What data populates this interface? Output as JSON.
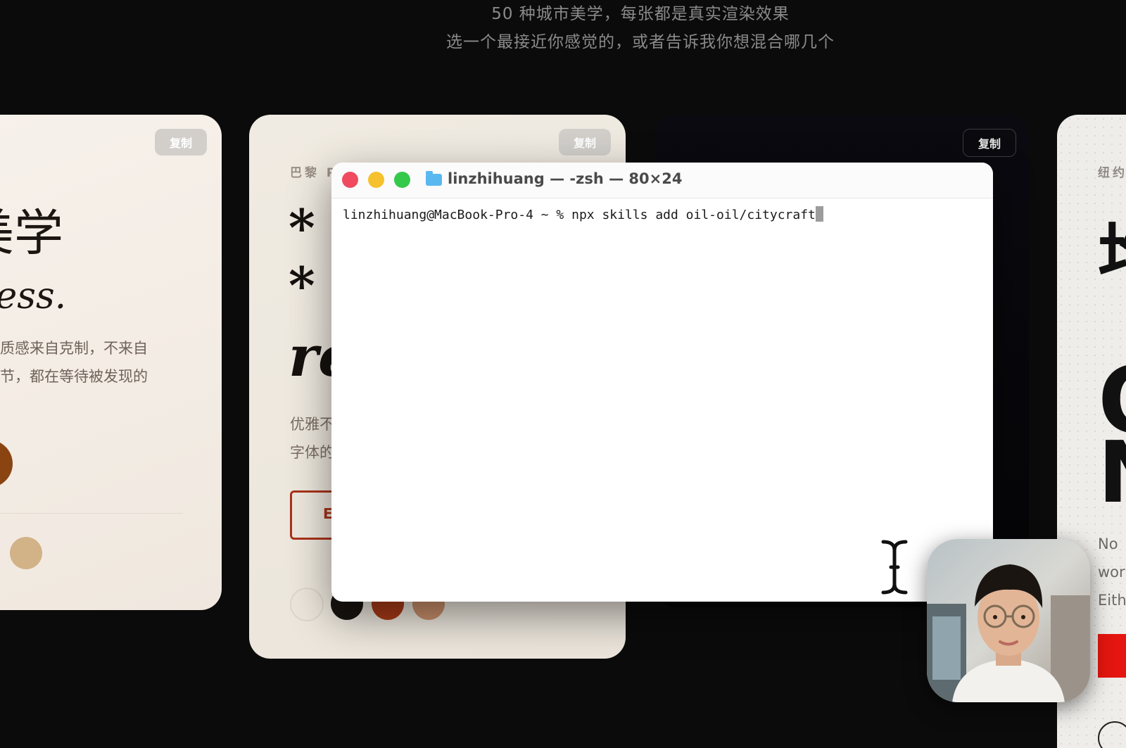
{
  "hero": {
    "line1": "50 种城市美学，每张都是真实渲染效果",
    "line2": "选一个最接近你感觉的，或者告诉我你想混合哪几个"
  },
  "cards": {
    "card1": {
      "copy_label": "复制",
      "title": "美学",
      "subtitle": "ness.",
      "body_line1": "质感来自克制，不来自",
      "body_line2": "节，都在等待被发现的",
      "swatches": [
        "#8a4412",
        "#d2b287"
      ]
    },
    "card2": {
      "copy_label": "复制",
      "city_label": "巴黎 P",
      "mark1": "*",
      "mark2": "*",
      "mark3": "re",
      "body_line1": "优雅不",
      "body_line2": "字体的",
      "button_label": "E",
      "swatches": [
        "#ebe5db",
        "#171310",
        "#a83a18",
        "#c98f6a"
      ]
    },
    "card3": {
      "copy_label": "复制"
    },
    "card4": {
      "city_label": "纽约",
      "big1": "圴",
      "big2": "O",
      "big3": "N",
      "body_line1": "No",
      "body_line2": "wor",
      "body_line3": "Eith"
    }
  },
  "terminal": {
    "title": "linzhihuang — -zsh — 80×24",
    "prompt": "linzhihuang@MacBook-Pro-4 ~ % ",
    "command": "npx skills add oil-oil/citycraft",
    "lights": {
      "close": "#ef4a5f",
      "minimize": "#f5c12c",
      "zoom": "#35c94b"
    },
    "folder_icon_color": "#5ab8f0"
  },
  "colors": {
    "background": "#0b0b0b",
    "accent_red": "#e4160f"
  }
}
